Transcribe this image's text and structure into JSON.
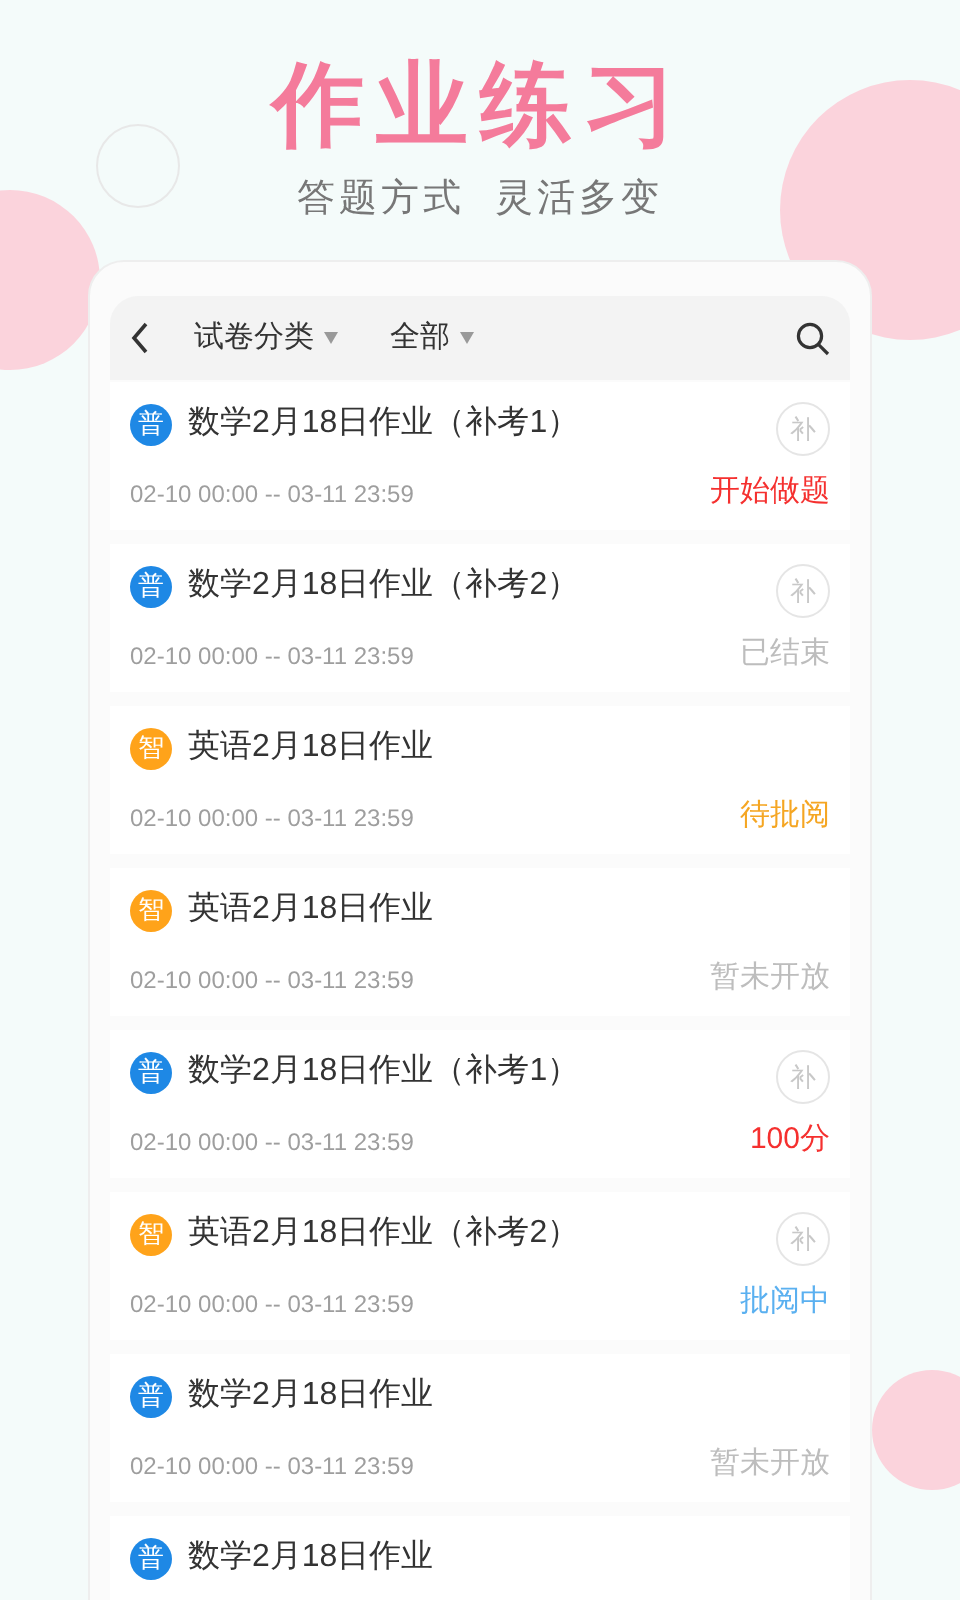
{
  "headline": "作业练习",
  "tagline": "答题方式  灵活多变",
  "toolbar": {
    "filters": [
      {
        "label": "试卷分类"
      },
      {
        "label": "全部"
      }
    ]
  },
  "items": [
    {
      "badge": {
        "text": "普",
        "color": "#1e88e5"
      },
      "title": "数学2月18日作业（补考1）",
      "time": "02-10 00:00 -- 03-11 23:59",
      "makeup": "补",
      "status": {
        "text": "开始做题",
        "color": "#f5302f"
      }
    },
    {
      "badge": {
        "text": "普",
        "color": "#1e88e5"
      },
      "title": "数学2月18日作业（补考2）",
      "time": "02-10 00:00 -- 03-11 23:59",
      "makeup": "补",
      "status": {
        "text": "已结束",
        "color": "#bdbdbd"
      }
    },
    {
      "badge": {
        "text": "智",
        "color": "#ffa31a"
      },
      "title": "英语2月18日作业",
      "time": "02-10 00:00 -- 03-11 23:59",
      "status": {
        "text": "待批阅",
        "color": "#f5a623"
      }
    },
    {
      "badge": {
        "text": "智",
        "color": "#ffa31a"
      },
      "title": "英语2月18日作业",
      "time": "02-10 00:00 -- 03-11 23:59",
      "status": {
        "text": "暂未开放",
        "color": "#bdbdbd"
      }
    },
    {
      "badge": {
        "text": "普",
        "color": "#1e88e5"
      },
      "title": "数学2月18日作业（补考1）",
      "time": "02-10 00:00 -- 03-11 23:59",
      "makeup": "补",
      "status": {
        "text": "100分",
        "color": "#f5302f"
      }
    },
    {
      "badge": {
        "text": "智",
        "color": "#ffa31a"
      },
      "title": "英语2月18日作业（补考2）",
      "time": "02-10 00:00 -- 03-11 23:59",
      "makeup": "补",
      "status": {
        "text": "批阅中",
        "color": "#5ab0f0"
      }
    },
    {
      "badge": {
        "text": "普",
        "color": "#1e88e5"
      },
      "title": "数学2月18日作业",
      "time": "02-10 00:00 -- 03-11 23:59",
      "status": {
        "text": "暂未开放",
        "color": "#bdbdbd"
      }
    },
    {
      "badge": {
        "text": "普",
        "color": "#1e88e5"
      },
      "title": "数学2月18日作业"
    }
  ]
}
